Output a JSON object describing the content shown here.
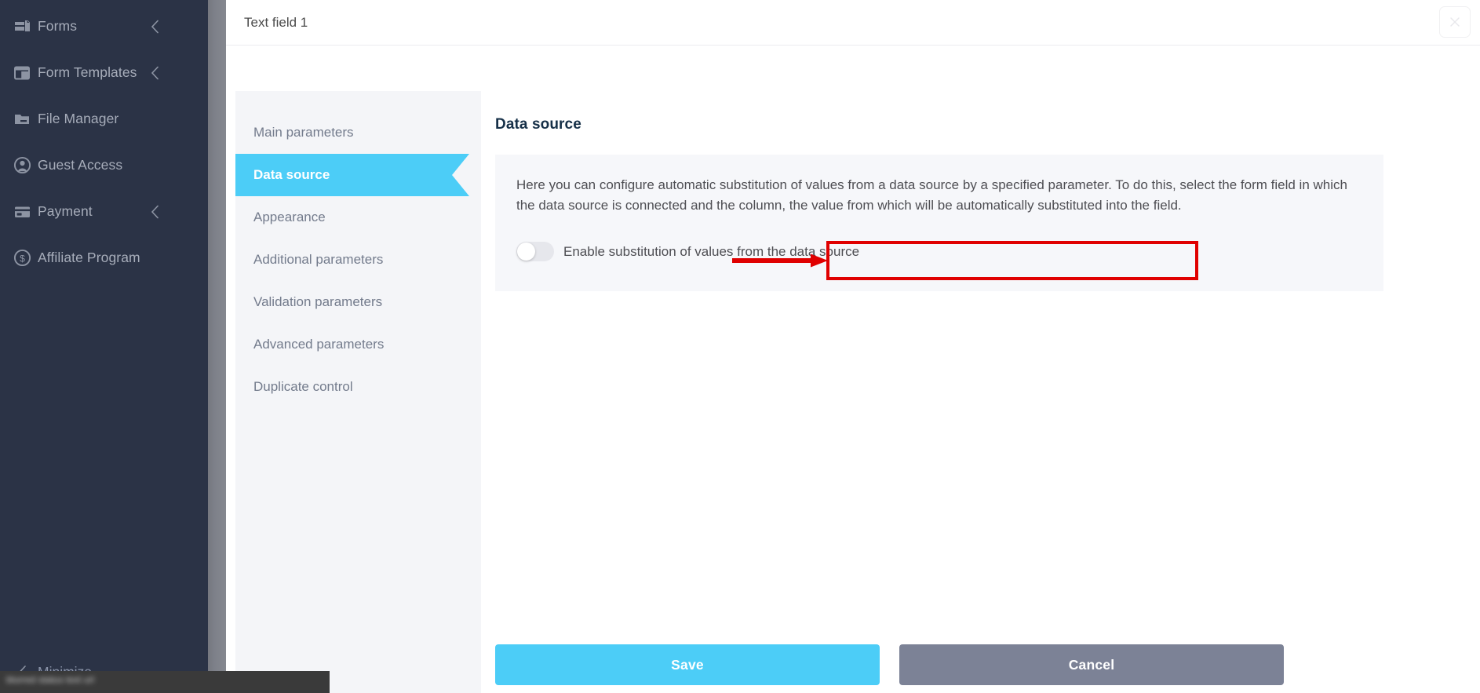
{
  "sidebar": {
    "items": [
      {
        "label": "Forms",
        "icon": "forms-icon",
        "has_chevron": true
      },
      {
        "label": "Form Templates",
        "icon": "form-templates-icon",
        "has_chevron": true
      },
      {
        "label": "File Manager",
        "icon": "file-manager-icon",
        "has_chevron": false
      },
      {
        "label": "Guest Access",
        "icon": "guest-access-icon",
        "has_chevron": false
      },
      {
        "label": "Payment",
        "icon": "payment-card-icon",
        "has_chevron": true
      },
      {
        "label": "Affiliate Program",
        "icon": "affiliate-dollar-icon",
        "has_chevron": false
      }
    ],
    "minimize_label": "Minimize",
    "background_color": "#2b3346"
  },
  "modal": {
    "title": "Text field 1",
    "close_icon": "close-icon"
  },
  "param_nav": {
    "items": [
      {
        "label": "Main parameters",
        "active": false
      },
      {
        "label": "Data source",
        "active": true
      },
      {
        "label": "Appearance",
        "active": false
      },
      {
        "label": "Additional parameters",
        "active": false
      },
      {
        "label": "Validation parameters",
        "active": false
      },
      {
        "label": "Advanced parameters",
        "active": false
      },
      {
        "label": "Duplicate control",
        "active": false
      }
    ],
    "active_color": "#4ccdf7"
  },
  "content": {
    "title": "Data source",
    "info_text": "Here you can configure automatic substitution of values from a data source by a specified parameter. To do this, select the form field in which the data source is connected and the column, the value from which will be automatically substituted into the field.",
    "toggle": {
      "label": "Enable substitution of values from the data source",
      "state": "off"
    }
  },
  "footer": {
    "save_label": "Save",
    "cancel_label": "Cancel",
    "save_color": "#4ccdf7",
    "cancel_color": "#7c8296"
  },
  "annotation": {
    "highlight_color": "#e00000",
    "arrow_color": "#e00000",
    "target": "enable-substitution-toggle"
  },
  "status_bar": {
    "text": "blurred status text url"
  }
}
